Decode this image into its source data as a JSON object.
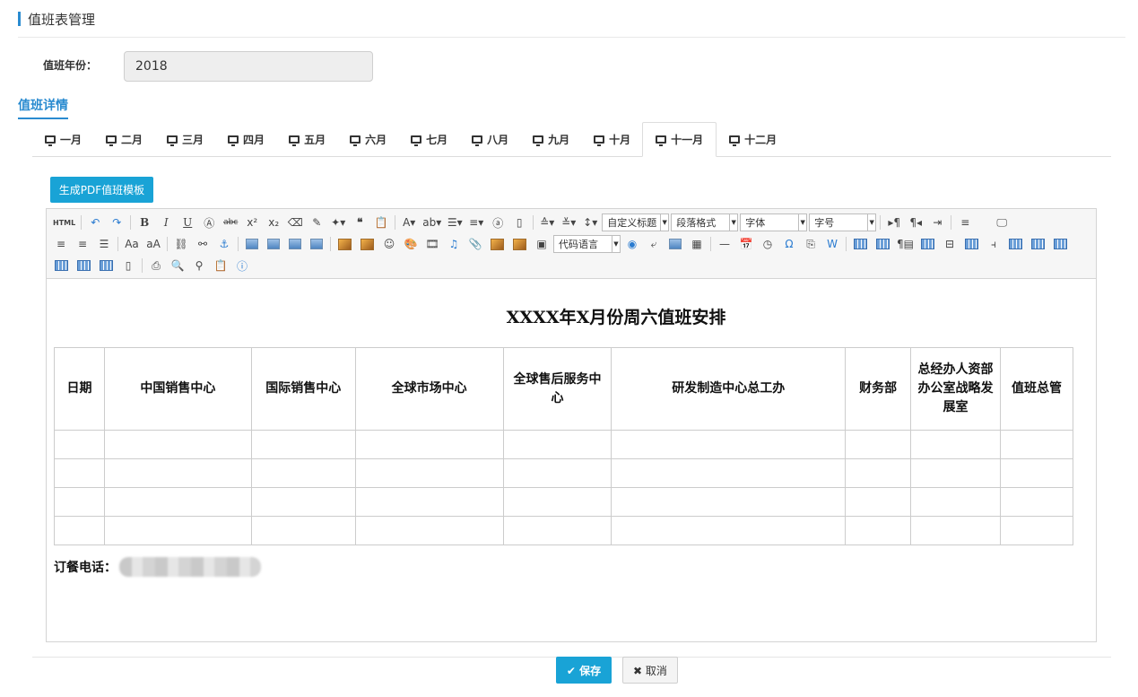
{
  "page": {
    "title": "值班表管理"
  },
  "form": {
    "year_label": "值班年份：",
    "year_value": "2018"
  },
  "section": {
    "title": "值班详情"
  },
  "tabs": [
    {
      "label": "一月"
    },
    {
      "label": "二月"
    },
    {
      "label": "三月"
    },
    {
      "label": "四月"
    },
    {
      "label": "五月"
    },
    {
      "label": "六月"
    },
    {
      "label": "七月"
    },
    {
      "label": "八月"
    },
    {
      "label": "九月"
    },
    {
      "label": "十月"
    },
    {
      "label": "十一月",
      "active": true
    },
    {
      "label": "十二月"
    }
  ],
  "actions": {
    "pdf_button": "生成PDF值班模板",
    "save": "保存",
    "cancel": "取消"
  },
  "toolbar": {
    "html_label": "HTML",
    "custom_heading": "自定义标题",
    "paragraph_format": "段落格式",
    "font_family": "字体",
    "font_size": "字号",
    "code_language": "代码语言"
  },
  "document": {
    "title": "XXXX年X月份周六值班安排",
    "columns": [
      "日期",
      "中国销售中心",
      "国际销售中心",
      "全球市场中心",
      "全球售后服务中心",
      "研发制造中心总工办",
      "财务部",
      "总经办人资部办公室战略发展室",
      "值班总管"
    ],
    "empty_rows": 4,
    "phone_label": "订餐电话："
  },
  "colors": {
    "accent": "#19a3d6",
    "link": "#2a8bd0"
  }
}
